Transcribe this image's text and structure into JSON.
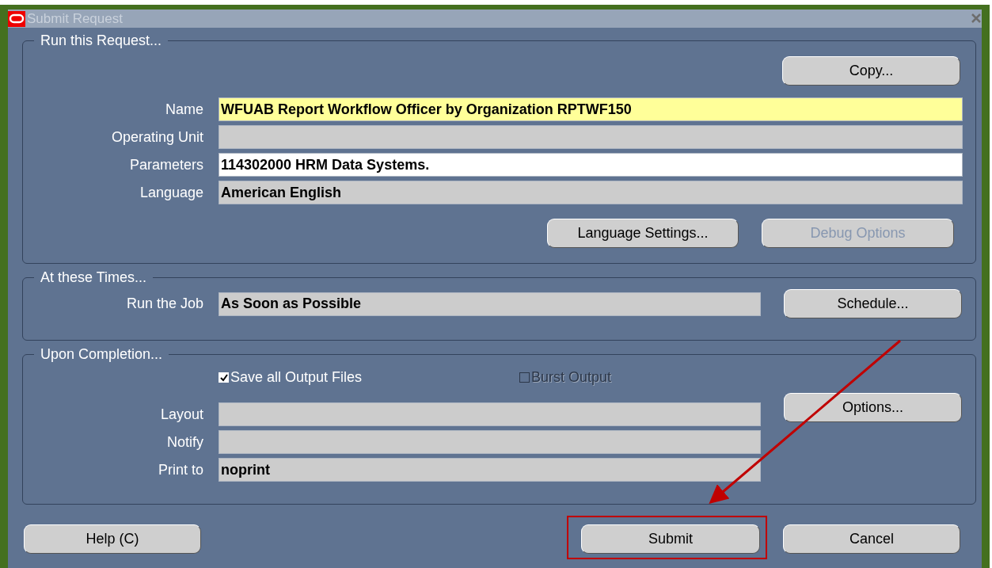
{
  "window": {
    "title": "Submit Request"
  },
  "run_request": {
    "legend": "Run this Request...",
    "copy_button": {
      "label": "Copy...",
      "disabled": false
    },
    "fields": [
      {
        "label": "Name",
        "value": "WFUAB Report Workflow Officer by Organization RPTWF150",
        "kind": "current"
      },
      {
        "label": "Operating Unit",
        "kind": "readonly"
      },
      {
        "label": "Parameters",
        "value": "114302000 HRM Data Systems.",
        "kind": "editable"
      },
      {
        "label": "Language",
        "value": "American English",
        "kind": "readonly"
      }
    ],
    "buttons": [
      {
        "label": "Language Settings...",
        "disabled": false
      },
      {
        "label": "Debug Options",
        "disabled": true
      }
    ]
  },
  "at_times": {
    "legend": "At these Times...",
    "fields": [
      {
        "label": "Run the Job",
        "value": "As Soon as Possible",
        "kind": "readonly"
      }
    ],
    "schedule_button": {
      "label": "Schedule...",
      "disabled": false
    }
  },
  "upon_completion": {
    "legend": "Upon Completion...",
    "checkboxes": [
      {
        "label": "Save all Output Files",
        "checked": true,
        "disabled": false
      },
      {
        "label": "Burst Output",
        "checked": false,
        "disabled": true
      }
    ],
    "fields": [
      {
        "label": "Layout",
        "kind": "readonly"
      },
      {
        "label": "Notify",
        "kind": "readonly"
      },
      {
        "label": "Print to",
        "value": "noprint",
        "kind": "readonly"
      }
    ],
    "options_button": {
      "label": "Options...",
      "disabled": false
    }
  },
  "footer_buttons": [
    {
      "label": "Help (C)",
      "highlighted": false
    },
    {
      "label": "Submit",
      "highlighted": true
    },
    {
      "label": "Cancel",
      "highlighted": false
    }
  ]
}
